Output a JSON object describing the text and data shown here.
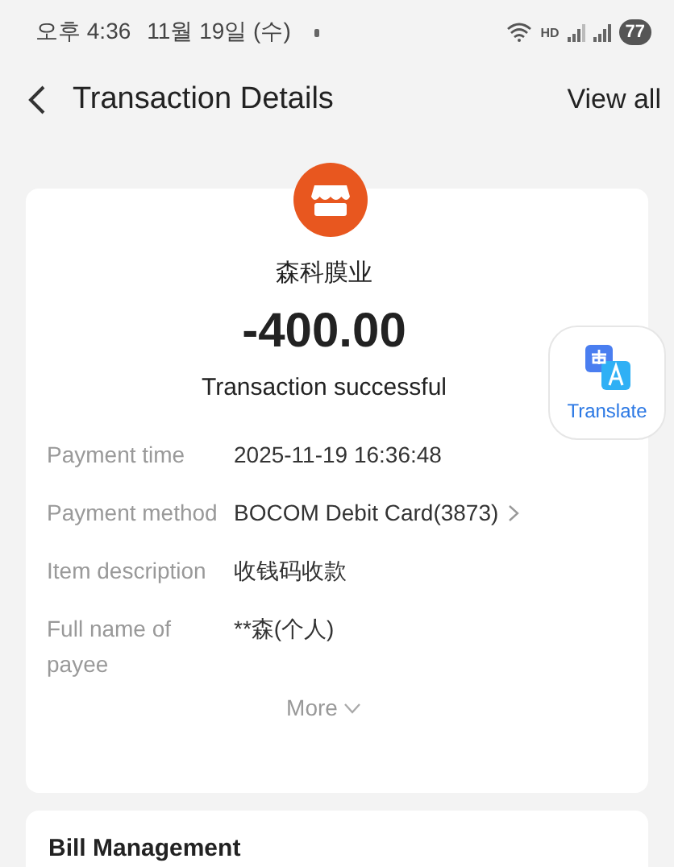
{
  "status_bar": {
    "time": "오후 4:36",
    "date": "11월 19일 (수)",
    "network": "HD",
    "battery": "77"
  },
  "header": {
    "title": "Transaction Details",
    "action": "View all"
  },
  "summary": {
    "merchant": "森科膜业",
    "amount": "-400.00",
    "status": "Transaction successful"
  },
  "translate": {
    "label": "Translate"
  },
  "details": [
    {
      "label": "Payment time",
      "value": "2025-11-19 16:36:48",
      "kind": "plain"
    },
    {
      "label": "Payment method",
      "value": "BOCOM Debit Card(3873)",
      "kind": "link"
    },
    {
      "label": "Item description",
      "value": "收钱码收款",
      "kind": "plain"
    },
    {
      "label": "Full name of payee",
      "value": "**森(个人)",
      "kind": "plain"
    }
  ],
  "more": "More",
  "bill_section": {
    "title": "Bill Management"
  }
}
